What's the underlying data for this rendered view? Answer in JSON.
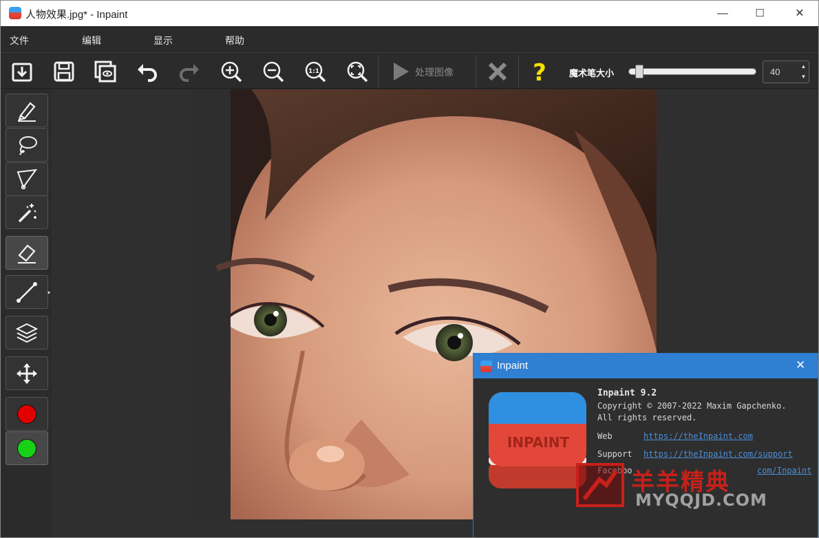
{
  "window": {
    "title": "人物效果.jpg* - Inpaint",
    "minimize": "—",
    "maximize": "☐",
    "close": "✕"
  },
  "menu": {
    "items": [
      "文件",
      "编辑",
      "显示",
      "帮助"
    ]
  },
  "toolbar": {
    "icons": [
      "open-icon",
      "save-icon",
      "save-as-icon",
      "undo-icon",
      "redo-icon",
      "zoom-in-icon",
      "zoom-out-icon",
      "actual-size-icon",
      "fit-window-icon",
      "play-icon",
      "clear-selection-icon",
      "help-icon"
    ],
    "process_label": "处理图像",
    "brush_size_label": "魔术笔大小",
    "brush_size_value": "40",
    "spin_up": "▲",
    "spin_down": "▼"
  },
  "tools": {
    "icons": [
      "marker-icon",
      "lasso-icon",
      "polygon-lasso-icon",
      "magic-wand-icon",
      "eraser-icon",
      "line-icon",
      "layers-icon",
      "move-icon"
    ],
    "dropdown": "▾",
    "colors": {
      "mask": "#e00000",
      "donor": "#17d117"
    }
  },
  "about": {
    "title": "Inpaint",
    "close": "✕",
    "heading": "Inpaint 9.2",
    "copyright": "Copyright © 2007-2022 Maxim Gapchenko.",
    "rights": "All rights reserved.",
    "web_label": "Web",
    "web_url": "https://theInpaint.com",
    "support_label": "Support",
    "support_url": "https://theInpaint.com/support",
    "facebook_label": "Faceboo",
    "facebook_url": "com/Inpaint",
    "logo_text": "INPAINT"
  },
  "watermark": {
    "cn": "羊羊精典",
    "en": "MYQQJD.COM"
  }
}
